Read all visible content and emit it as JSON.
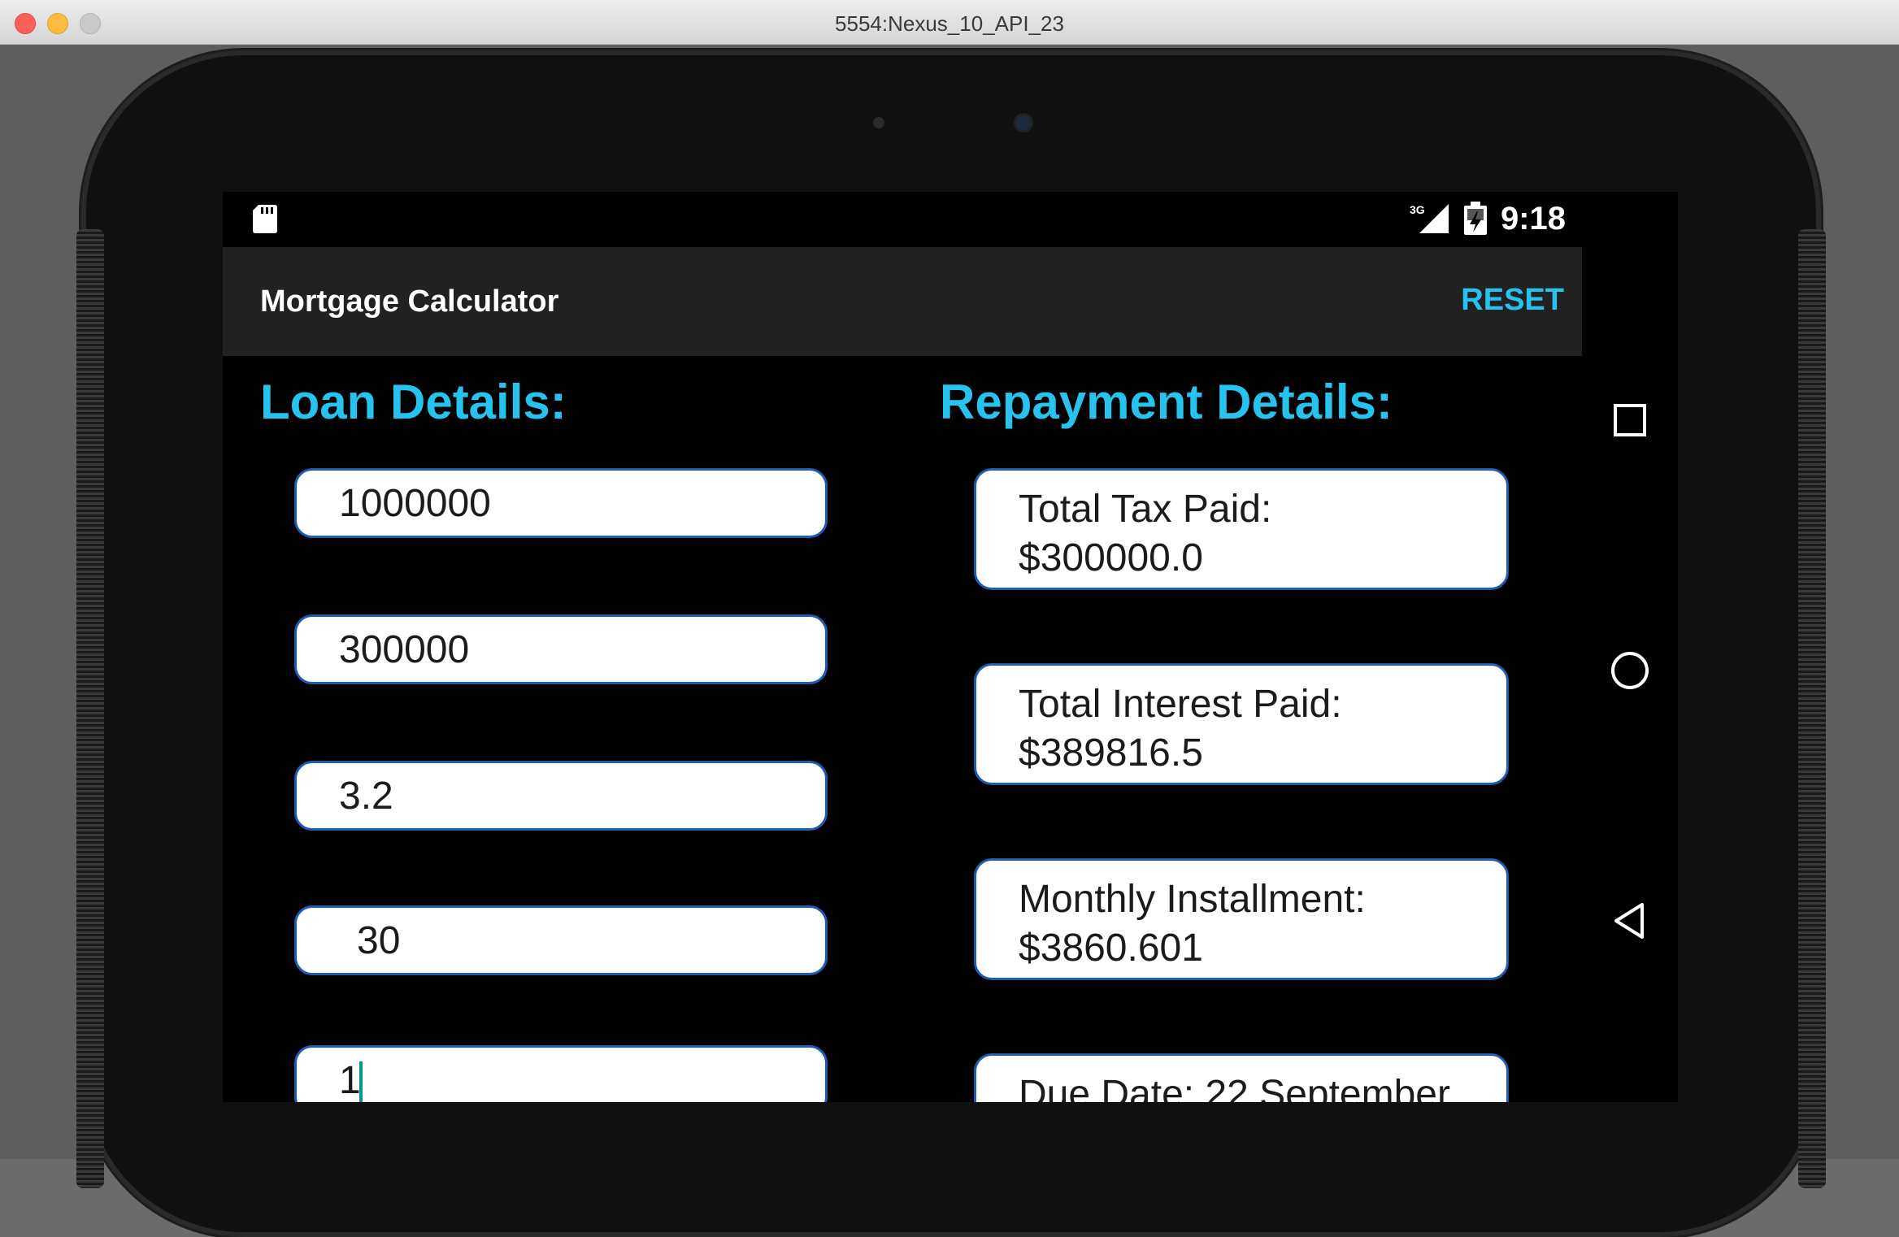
{
  "window": {
    "title": "5554:Nexus_10_API_23"
  },
  "status_bar": {
    "network": "3G",
    "time": "9:18"
  },
  "action_bar": {
    "title": "Mortgage Calculator",
    "reset_label": "RESET"
  },
  "loan_details": {
    "heading": "Loan Details:",
    "fields": [
      {
        "value": "1000000"
      },
      {
        "value": "300000"
      },
      {
        "value": "3.2"
      },
      {
        "value": "30"
      },
      {
        "value": "1"
      }
    ]
  },
  "repayment_details": {
    "heading": "Repayment Details:",
    "results": [
      {
        "label": "Total Tax Paid:",
        "value": "$300000.0"
      },
      {
        "label": "Total Interest Paid:",
        "value": "$389816.5"
      },
      {
        "label": "Monthly Installment:",
        "value": "$3860.601"
      },
      {
        "label": "Due Date: 22 September",
        "value": ""
      }
    ]
  },
  "colors": {
    "accent": "#27c3ef",
    "field_border": "#1e5bb5",
    "cursor": "#009688",
    "action_bar": "#212121"
  },
  "icons": {
    "status": [
      "sd-card-icon",
      "signal-3g-icon",
      "battery-charging-icon"
    ],
    "navigation": [
      "recents-square-icon",
      "home-circle-icon",
      "back-triangle-icon"
    ]
  }
}
